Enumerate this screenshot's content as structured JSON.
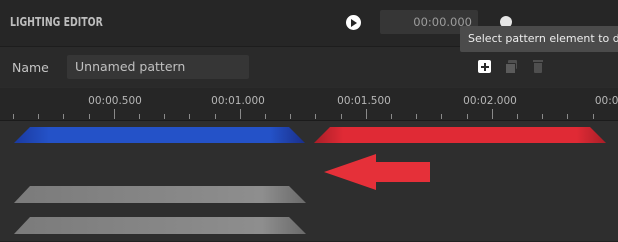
{
  "header": {
    "title": "LIGHTING EDITOR",
    "time": "00:00.000"
  },
  "tooltip": {
    "text": "Select pattern element to d"
  },
  "pattern": {
    "name_label": "Name",
    "name_value": "Unnamed pattern"
  },
  "ruler": {
    "labels": [
      "00:00.500",
      "00:01.000",
      "00:01.500",
      "00:02.000",
      "00:02"
    ]
  },
  "colors": {
    "blue_block": "#2452c8",
    "red_block": "#e02a35",
    "gray_block": "#8a8a8a",
    "arrow": "#e53039"
  },
  "icons": [
    "play-icon",
    "add-icon",
    "copy-icon",
    "trash-icon"
  ]
}
